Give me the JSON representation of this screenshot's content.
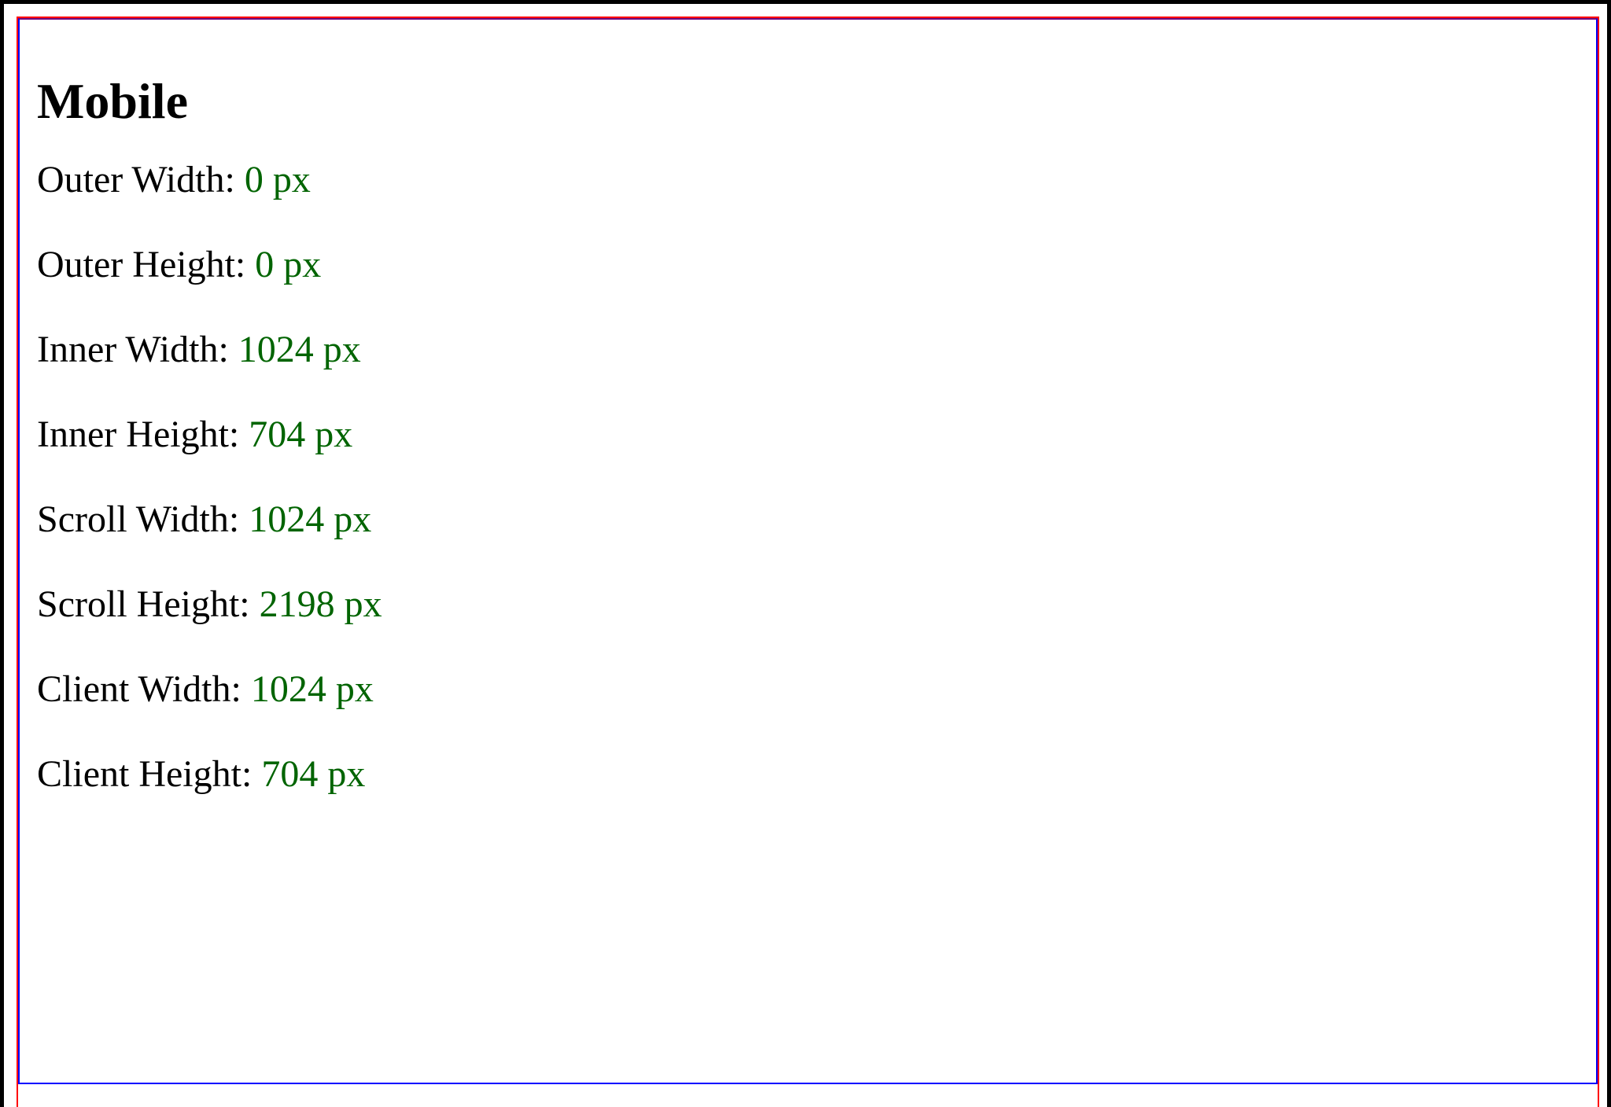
{
  "page": {
    "title": "Mobile"
  },
  "metrics": [
    {
      "label": "Outer Width:",
      "value": "0 px"
    },
    {
      "label": "Outer Height:",
      "value": "0 px"
    },
    {
      "label": "Inner Width:",
      "value": "1024 px"
    },
    {
      "label": "Inner Height:",
      "value": "704 px"
    },
    {
      "label": "Scroll Width:",
      "value": "1024 px"
    },
    {
      "label": "Scroll Height:",
      "value": "2198 px"
    },
    {
      "label": "Client Width:",
      "value": "1024 px"
    },
    {
      "label": "Client Height:",
      "value": "704 px"
    }
  ],
  "colors": {
    "value_text": "#006400",
    "outer_border": "#000000",
    "red_box": "#ff0000",
    "blue_box": "#0000ff"
  }
}
